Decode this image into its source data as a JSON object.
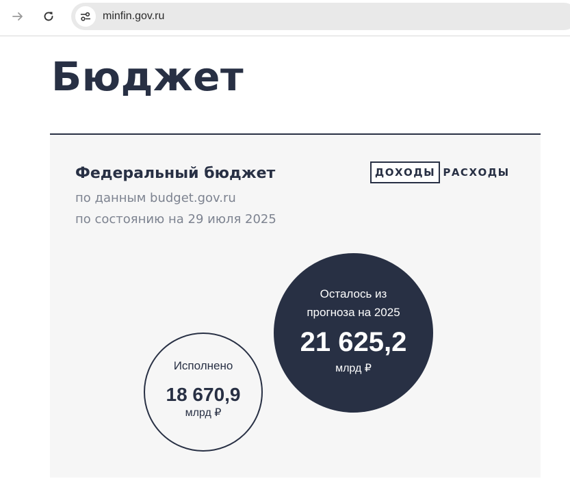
{
  "browser": {
    "url": "minfin.gov.ru"
  },
  "page": {
    "title": "Бюджет"
  },
  "budget_card": {
    "title": "Федеральный бюджет",
    "source": "по данным budget.gov.ru",
    "as_of": "по состоянию на 29 июля 2025",
    "tabs": [
      {
        "label": "ДОХОДЫ",
        "selected": true
      },
      {
        "label": "РАСХОДЫ",
        "selected": false
      }
    ],
    "executed": {
      "label": "Исполнено",
      "value": "18 670,9",
      "unit": "млрд ₽"
    },
    "remaining": {
      "label": "Осталось из прогноза на 2025",
      "value": "21 625,2",
      "unit": "млрд ₽"
    }
  },
  "colors": {
    "primary": "#283044",
    "card_background": "#f6f6f6",
    "muted_text": "#7d8390"
  }
}
